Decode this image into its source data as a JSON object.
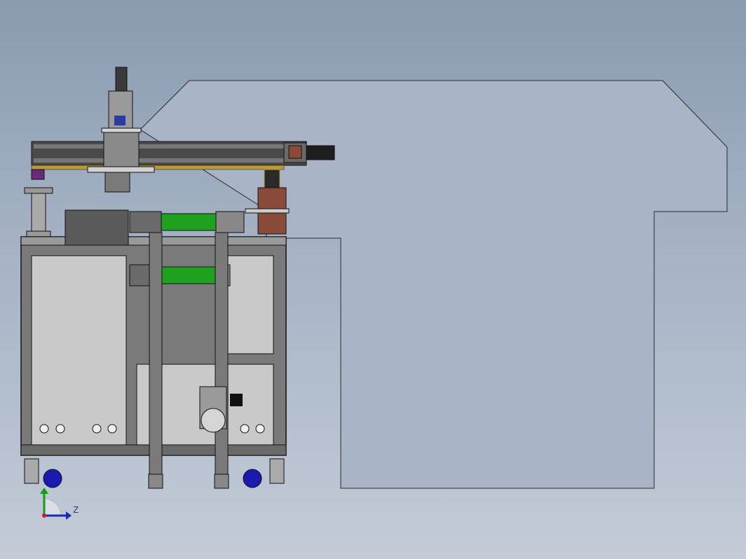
{
  "viewport": {
    "background_top": "#8a9bb0",
    "background_bottom": "#c3cbd7"
  },
  "colors": {
    "outline": "#1f1f1f",
    "frame": "#8b8b8b",
    "panel": "#c9c9c9",
    "rail": "#3a3a3a",
    "green_cylinder": "#1fa01f",
    "brown_block": "#8a4a3a",
    "purple_block": "#6a2a7a",
    "caster_blue": "#1a1ab0",
    "gold_trim": "#b89a3a"
  },
  "triad": {
    "z_label": "Z",
    "icon": "coordinate-triad-icon"
  }
}
